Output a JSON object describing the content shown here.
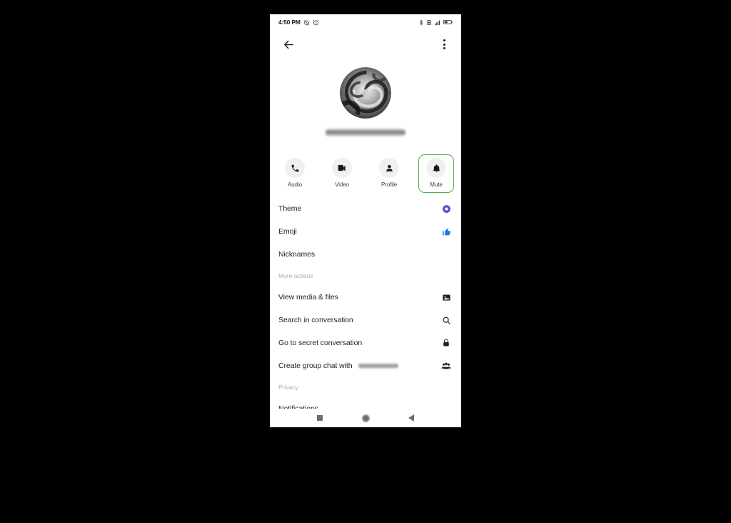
{
  "status_bar": {
    "time": "4:50 PM",
    "left_icons": [
      "alarm-off-icon",
      "clock-icon"
    ],
    "right_icons": [
      "bluetooth-icon",
      "sim-card-icon",
      "signal-bars-icon",
      "battery-icon"
    ]
  },
  "app_bar": {
    "back_icon": "arrow-left-icon",
    "overflow_icon": "more-vertical-icon"
  },
  "profile": {
    "avatar_alt": "swirl-avatar",
    "name_redacted": true
  },
  "quick_actions": [
    {
      "label": "Audio",
      "icon": "phone-icon",
      "selected": false
    },
    {
      "label": "Video",
      "icon": "videocam-icon",
      "selected": false
    },
    {
      "label": "Profile",
      "icon": "person-icon",
      "selected": false
    },
    {
      "label": "Mute",
      "icon": "bell-icon",
      "selected": true
    }
  ],
  "selection_color": "#4caf50",
  "list": [
    {
      "type": "row",
      "label": "Theme",
      "icon": "theme-circle-icon",
      "icon_color": "#5b4fc4"
    },
    {
      "type": "row",
      "label": "Emoji",
      "icon": "thumbs-up-icon",
      "icon_color": "#1877f2"
    },
    {
      "type": "row",
      "label": "Nicknames",
      "icon": null,
      "icon_color": null
    },
    {
      "type": "section",
      "label": "More actions"
    },
    {
      "type": "row",
      "label": "View media & files",
      "icon": "image-icon",
      "icon_color": "#1f1f1f"
    },
    {
      "type": "row",
      "label": "Search in conversation",
      "icon": "search-icon",
      "icon_color": "#1f1f1f"
    },
    {
      "type": "row",
      "label": "Go to secret conversation",
      "icon": "lock-icon",
      "icon_color": "#1f1f1f"
    },
    {
      "type": "row",
      "label": "Create group chat with",
      "icon": "group-icon",
      "icon_color": "#1f1f1f",
      "redacted_suffix": true
    },
    {
      "type": "section",
      "label": "Privacy"
    },
    {
      "type": "row",
      "label": "Notifications",
      "icon": null,
      "icon_color": null
    }
  ],
  "nav_bar": {
    "recents_icon": "square-icon",
    "home_icon": "circle-icon",
    "back_icon": "triangle-back-icon"
  }
}
